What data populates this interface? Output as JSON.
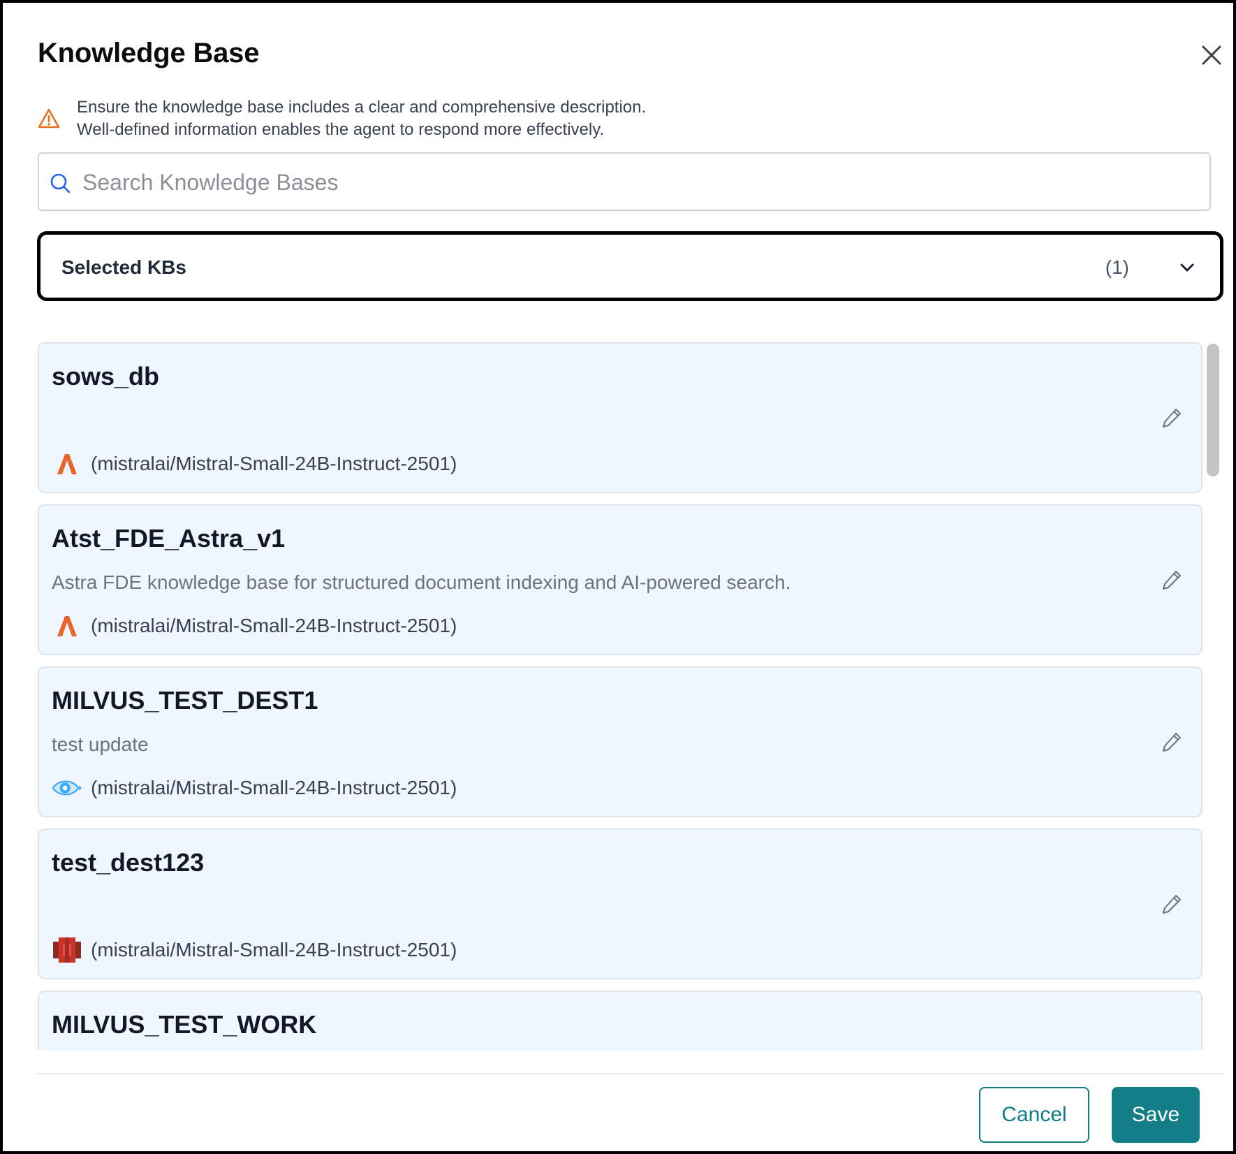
{
  "dialog": {
    "title": "Knowledge Base",
    "close_icon": "close-icon"
  },
  "warning": {
    "icon": "warning-triangle-icon",
    "line1": "Ensure the knowledge base includes a clear and comprehensive description.",
    "line2": "Well-defined information enables the agent to respond more effectively.",
    "color": "#e8711f"
  },
  "search": {
    "icon": "search-icon",
    "placeholder": "Search Knowledge Bases",
    "value": ""
  },
  "selected": {
    "label": "Selected KBs",
    "count": "(1)",
    "expanded": false
  },
  "kb_list": [
    {
      "name": "sows_db",
      "description": "",
      "provider_icon": "astra-icon",
      "model": "(mistralai/Mistral-Small-24B-Instruct-2501)"
    },
    {
      "name": "Atst_FDE_Astra_v1",
      "description": "Astra FDE knowledge base for structured document indexing and AI-powered search.",
      "provider_icon": "astra-icon",
      "model": "(mistralai/Mistral-Small-24B-Instruct-2501)"
    },
    {
      "name": "MILVUS_TEST_DEST1",
      "description": "test update",
      "provider_icon": "milvus-icon",
      "model": "(mistralai/Mistral-Small-24B-Instruct-2501)"
    },
    {
      "name": "test_dest123",
      "description": "",
      "provider_icon": "aws-s3-icon",
      "model": "(mistralai/Mistral-Small-24B-Instruct-2501)"
    },
    {
      "name": "MILVUS_TEST_WORK",
      "description": "",
      "provider_icon": "",
      "model": ""
    }
  ],
  "footer": {
    "cancel_label": "Cancel",
    "save_label": "Save"
  },
  "colors": {
    "accent": "#137e88",
    "card_background": "#eff6fe",
    "astra_orange": "#e8652a",
    "milvus_blue": "#3fa9f5",
    "s3_red": "#c9342a",
    "warning_orange": "#e8711f"
  }
}
